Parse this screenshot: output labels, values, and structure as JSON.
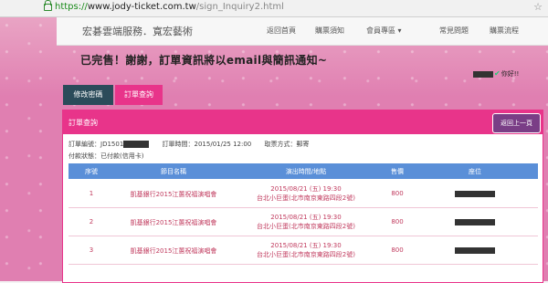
{
  "browser": {
    "url_https": "https://",
    "url_host": "www.jody-ticket.com.tw",
    "url_path": "/sign_Inquiry2.html"
  },
  "site": {
    "brand": "宏碁雲端服務．寬宏藝術",
    "nav": [
      "返回首頁",
      "購票須知",
      "會員專區 ▾",
      "常見問題",
      "購票流程"
    ]
  },
  "welcome": "已完售！謝謝，訂單資訊將以email與簡訊通知~",
  "user": {
    "greeting": "你好!!"
  },
  "tabs": [
    "修改密碼",
    "訂單查詢"
  ],
  "panel": {
    "title": "訂單查詢",
    "back_button": "返回上一頁",
    "order_no_label": "訂單編號：JD1501",
    "order_time": "訂單時間：2015/01/25 12:00",
    "pickup": "取票方式：郵寄",
    "payment": "付款狀態：已付款(信用卡)"
  },
  "table": {
    "headers": [
      "序號",
      "節目名稱",
      "演出時間/地點",
      "售價",
      "座位"
    ],
    "rows": [
      {
        "no": "1",
        "name": "凱基銀行2015江蕙祝福演唱會",
        "time": "2015/08/21 (五) 19:30",
        "venue": "台北小巨蛋(北市南京東路四段2號)",
        "price": "800"
      },
      {
        "no": "2",
        "name": "凱基銀行2015江蕙祝福演唱會",
        "time": "2015/08/21 (五) 19:30",
        "venue": "台北小巨蛋(北市南京東路四段2號)",
        "price": "800"
      },
      {
        "no": "3",
        "name": "凱基銀行2015江蕙祝福演唱會",
        "time": "2015/08/21 (五) 19:30",
        "venue": "台北小巨蛋(北市南京東路四段2號)",
        "price": "800"
      }
    ]
  }
}
